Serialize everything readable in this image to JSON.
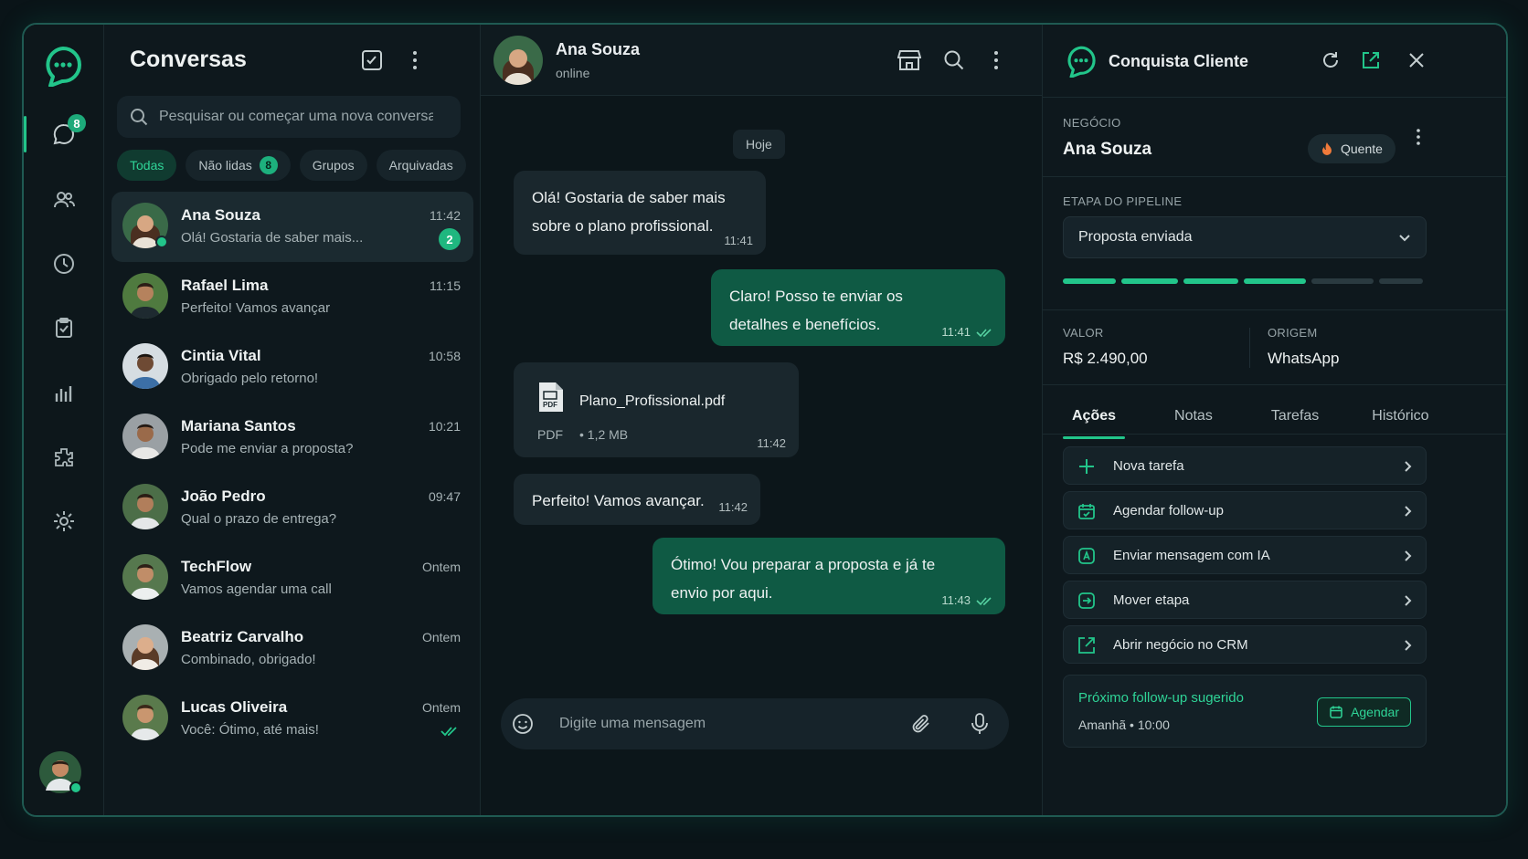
{
  "colors": {
    "accent": "#22c58a",
    "outgoing_bubble": "#0f5a44",
    "incoming_bubble": "#1a272d",
    "background": "#0b1419"
  },
  "rail": {
    "unread_badge": "8",
    "icons": [
      "logo-chat-icon",
      "chats-icon",
      "contacts-icon",
      "history-icon",
      "tasks-icon",
      "reports-icon",
      "integrations-icon",
      "settings-icon"
    ]
  },
  "conversations": {
    "title": "Conversas",
    "search_placeholder": "Pesquisar ou começar uma nova conversa",
    "filters": {
      "all": "Todas",
      "unread": "Não lidas",
      "unread_count": "8",
      "groups": "Grupos",
      "archived": "Arquivadas"
    },
    "items": [
      {
        "name": "Ana Souza",
        "preview": "Olá! Gostaria de saber mais...",
        "time": "11:42",
        "unread": "2"
      },
      {
        "name": "Rafael Lima",
        "preview": "Perfeito! Vamos avançar",
        "time": "11:15"
      },
      {
        "name": "Cintia Vital",
        "preview": "Obrigado pelo retorno!",
        "time": "10:58"
      },
      {
        "name": "Mariana Santos",
        "preview": "Pode me enviar a proposta?",
        "time": "10:21"
      },
      {
        "name": "João Pedro",
        "preview": "Qual o prazo de entrega?",
        "time": "09:47"
      },
      {
        "name": "TechFlow",
        "preview": "Vamos agendar uma call",
        "time": "Ontem"
      },
      {
        "name": "Beatriz Carvalho",
        "preview": "Combinado, obrigado!",
        "time": "Ontem"
      },
      {
        "name": "Lucas Oliveira",
        "preview": "Você: Ótimo, até mais!",
        "time": "Ontem"
      }
    ]
  },
  "chat": {
    "contact_name": "Ana Souza",
    "status": "online",
    "day_label": "Hoje",
    "messages": [
      {
        "dir": "in",
        "text": "Olá! Gostaria de saber mais sobre o plano profissional.",
        "time": "11:41"
      },
      {
        "dir": "out",
        "text": "Claro! Posso te enviar os detalhes e benefícios.",
        "time": "11:41"
      },
      {
        "dir": "in",
        "file_name": "Plano_Profissional.pdf",
        "file_type": "PDF",
        "file_size": "• 1,2 MB",
        "time": "11:42"
      },
      {
        "dir": "in",
        "text": "Perfeito! Vamos avançar.",
        "time": "11:42"
      },
      {
        "dir": "out",
        "text": "Ótimo! Vou preparar a proposta e já te envio por aqui.",
        "time": "11:43"
      }
    ],
    "composer_placeholder": "Digite uma mensagem"
  },
  "crm": {
    "brand": "Conquista Cliente",
    "deal_label": "NEGÓCIO",
    "deal_name": "Ana Souza",
    "temperature": "Quente",
    "pipeline_label": "ETAPA DO PIPELINE",
    "pipeline_stage": "Proposta enviada",
    "pipeline_progress": {
      "completed": 4,
      "total": 6
    },
    "value_label": "VALOR",
    "value": "R$ 2.490,00",
    "origin_label": "ORIGEM",
    "origin": "WhatsApp",
    "tabs": [
      "Ações",
      "Notas",
      "Tarefas",
      "Histórico"
    ],
    "actions": [
      "Nova tarefa",
      "Agendar follow-up",
      "Enviar mensagem com IA",
      "Mover etapa",
      "Abrir negócio no CRM"
    ],
    "suggestion": {
      "title": "Próximo follow-up sugerido",
      "detail": "Amanhã • 10:00",
      "button": "Agendar"
    }
  }
}
